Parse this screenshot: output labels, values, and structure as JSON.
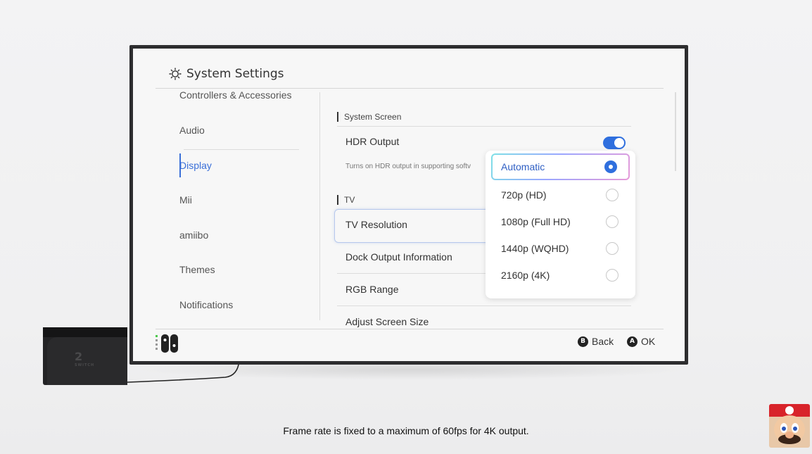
{
  "window": {
    "title": "System Settings",
    "icon": "gear-icon"
  },
  "sidebar": {
    "items": [
      {
        "label": "Controllers & Accessories",
        "active": false
      },
      {
        "label": "Audio",
        "active": false
      },
      {
        "label": "Display",
        "active": true
      },
      {
        "label": "Mii",
        "active": false
      },
      {
        "label": "amiibo",
        "active": false
      },
      {
        "label": "Themes",
        "active": false
      },
      {
        "label": "Notifications",
        "active": false
      }
    ]
  },
  "content": {
    "system_screen_label": "System Screen",
    "hdr_output": {
      "label": "HDR Output",
      "enabled": true,
      "description": "Turns on HDR output in supporting softv"
    },
    "tv_label": "TV",
    "tv_resolution_label": "TV Resolution",
    "dock_output_label": "Dock Output Information",
    "rgb_range_label": "RGB Range",
    "adjust_screen_label": "Adjust Screen Size"
  },
  "resolution_dropdown": {
    "options": [
      {
        "label": "Automatic",
        "selected": true
      },
      {
        "label": "720p (HD)",
        "selected": false
      },
      {
        "label": "1080p (Full HD)",
        "selected": false
      },
      {
        "label": "1440p (WQHD)",
        "selected": false
      },
      {
        "label": "2160p (4K)",
        "selected": false
      }
    ]
  },
  "footer": {
    "back": {
      "button": "B",
      "label": "Back"
    },
    "ok": {
      "button": "A",
      "label": "OK"
    }
  },
  "dock": {
    "logo_text": "2",
    "brand": "SWITCH"
  },
  "caption": "Frame rate is fixed to a maximum of 60fps for 4K output.",
  "colors": {
    "accent": "#2f6fde",
    "active_text": "#3a6fd8",
    "tv_bezel": "#2d2d2f"
  }
}
